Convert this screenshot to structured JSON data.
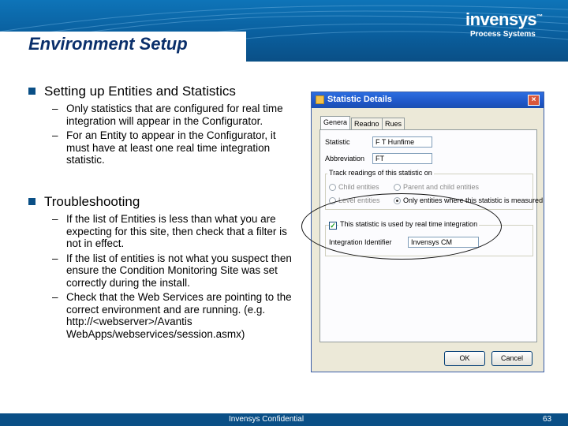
{
  "header": {
    "title": "Environment Setup",
    "logo_text": "invensys",
    "logo_mark": "™",
    "logo_subtitle": "Process Systems"
  },
  "bullets": [
    {
      "text": "Setting up Entities and Statistics",
      "subs": [
        "Only statistics that are configured for real time integration will appear in the Configurator.",
        "For an Entity to appear in the Configurator, it must have at least one real time integration statistic."
      ]
    },
    {
      "text": "Troubleshooting",
      "subs": [
        "If the list of Entities is less than what you are expecting for this site, then check that a filter is not in effect.",
        "If the list of entities is not what you suspect then ensure the Condition Monitoring Site was set correctly during the install.",
        "Check that the Web Services are pointing to the correct environment and are running. (e.g. http://<webserver>/Avantis WebApps/webservices/session.asmx)"
      ]
    }
  ],
  "dialog": {
    "title": "Statistic Details",
    "close_glyph": "×",
    "tabs": [
      "Genera",
      "Readno",
      "Rues"
    ],
    "statistic_label": "Statistic",
    "statistic_value": "F T Hunfime",
    "abbreviation_label": "Abbreviation",
    "abbreviation_value": "FT",
    "group_track_title": "Track readings of this statistic on",
    "radio_child": "Child entities",
    "radio_parent": "Parent and child entities",
    "radio_level": "Level entities",
    "radio_only": "Only entities where this statistic is measured",
    "realtime_check_label": "This statistic is used by real time integration",
    "check_glyph": "✓",
    "integration_label": "Integration Identifier",
    "integration_value": "Invensys CM",
    "ok_label": "OK",
    "cancel_label": "Cancel"
  },
  "footer": {
    "text": "Invensys Confidential",
    "page_number": "63"
  }
}
